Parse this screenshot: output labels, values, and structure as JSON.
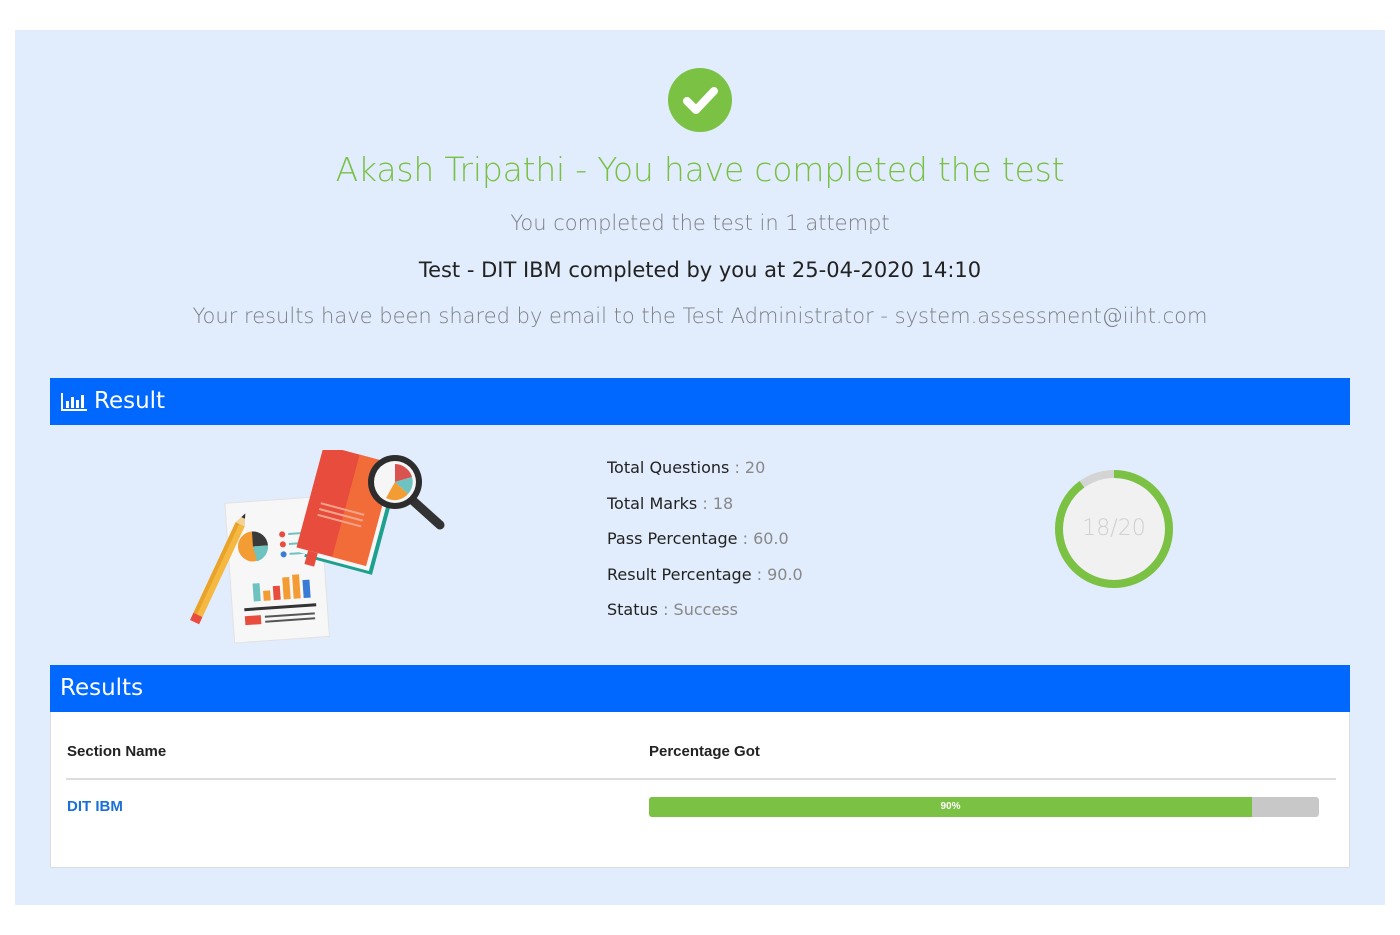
{
  "header": {
    "title": "Akash Tripathi - You have completed the test",
    "attempt_text": "You completed the test in 1 attempt",
    "completed_text": "Test - DIT IBM completed by you at 25-04-2020 14:10",
    "shared_text": "Your results have been shared by email to the Test Administrator - system.assessment@iiht.com"
  },
  "result_panel": {
    "title": "Result",
    "icon": "bar-chart-icon",
    "stats": [
      {
        "label": "Total Questions",
        "sep": " : ",
        "value": "20"
      },
      {
        "label": "Total Marks",
        "sep": " : ",
        "value": "18"
      },
      {
        "label": "Pass Percentage",
        "sep": " : ",
        "value": "60.0"
      },
      {
        "label": "Result Percentage",
        "sep": " : ",
        "value": "90.0"
      },
      {
        "label": "Status",
        "sep": " : ",
        "value": "Success"
      }
    ],
    "score_text": "18/20",
    "score_fraction": 0.9
  },
  "results_table": {
    "title": "Results",
    "headers": {
      "section": "Section Name",
      "percentage": "Percentage Got"
    },
    "rows": [
      {
        "section": "DIT IBM",
        "percent_label": "90%",
        "percent": 90
      }
    ]
  },
  "colors": {
    "accent_green": "#7bc144",
    "header_blue": "#0068ff",
    "background": "#e1edfc"
  }
}
